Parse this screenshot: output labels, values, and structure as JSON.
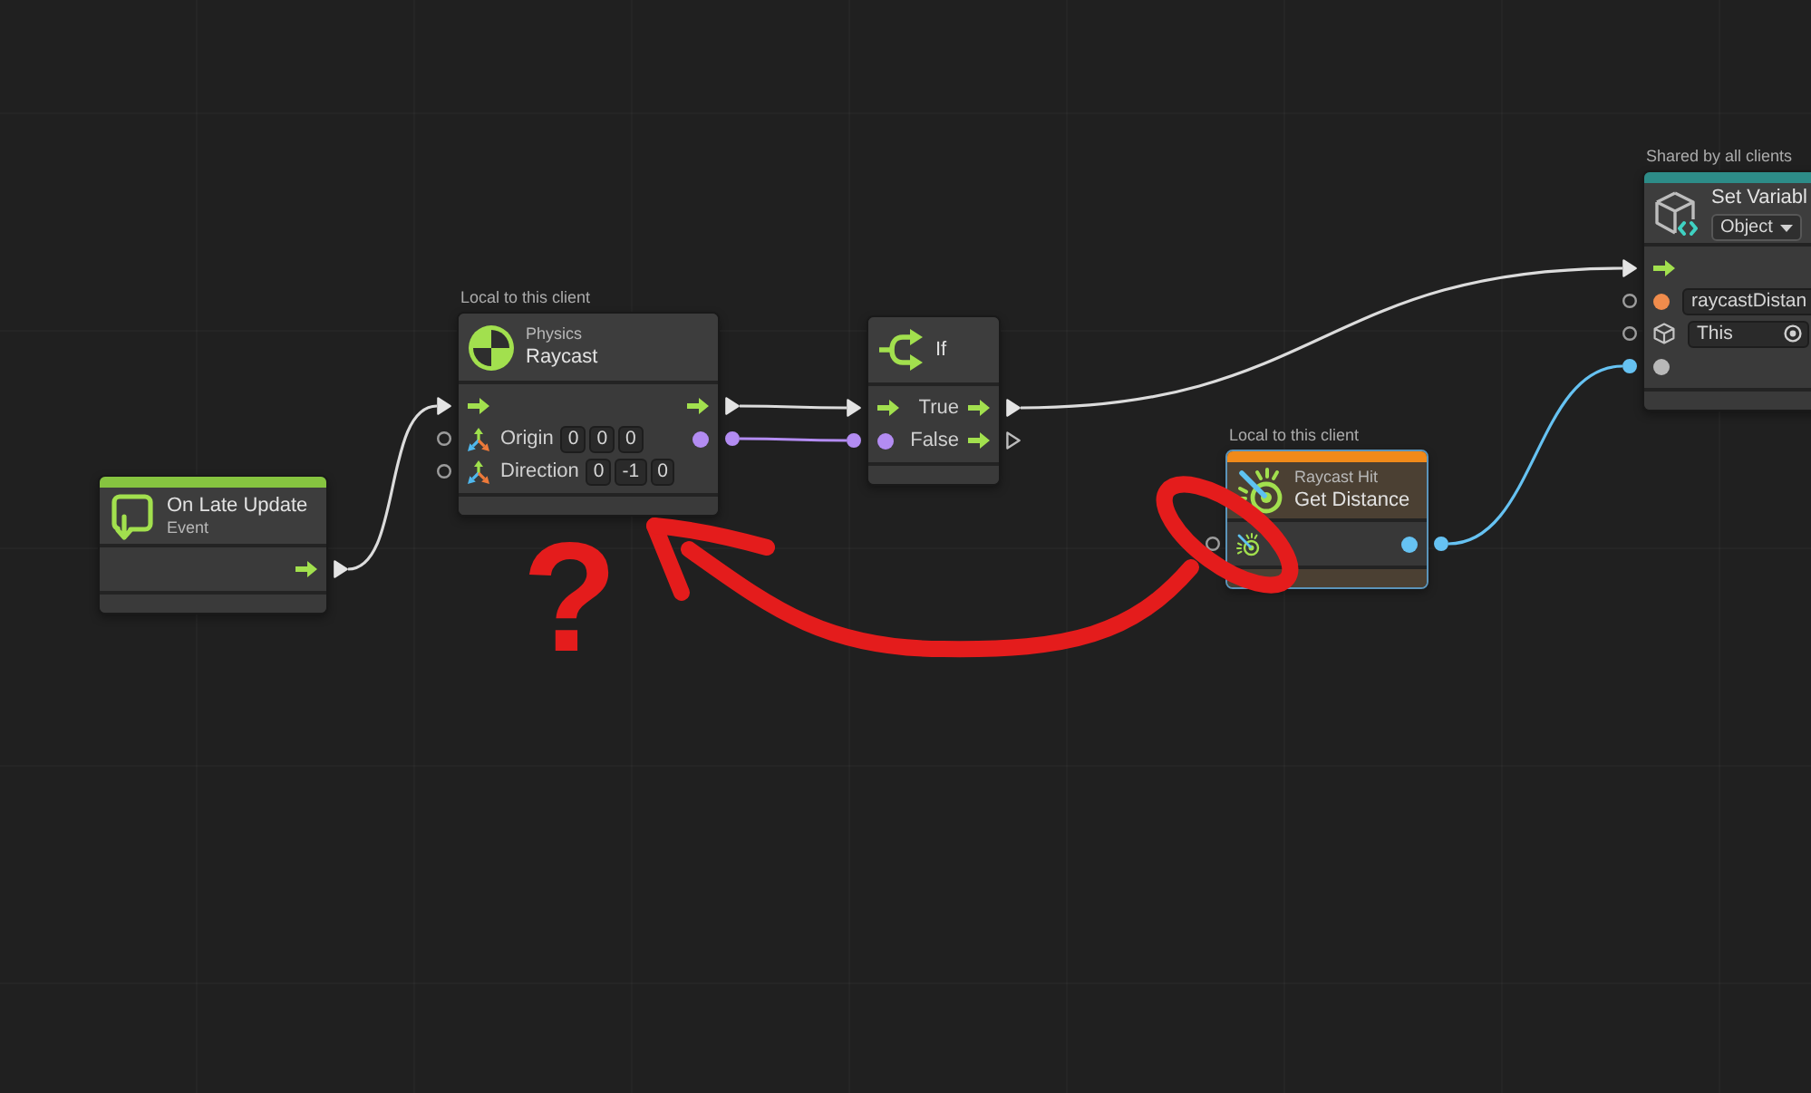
{
  "nodes": [
    {
      "kind": "event",
      "title": "On Late Update",
      "subtitle": "Event",
      "color": "#86c440",
      "selected": false,
      "rows": [
        {
          "out": {
            "kind": "flow",
            "connected": true
          }
        }
      ]
    },
    {
      "kind": "raycast",
      "scope": "Local to this client",
      "category": "Physics",
      "title": "Raycast",
      "selected": false,
      "rows": [
        {
          "in": {
            "kind": "flow",
            "connected": true
          },
          "out": {
            "kind": "flow",
            "connected": true
          }
        },
        {
          "in": {
            "kind": "vector",
            "connected": false,
            "label": "Origin",
            "fields": [
              "0",
              "0",
              "0"
            ]
          },
          "out": {
            "kind": "value",
            "color": "#b38cf2",
            "connected": true
          }
        },
        {
          "in": {
            "kind": "vector",
            "connected": false,
            "label": "Direction",
            "fields": [
              "0",
              "-1",
              "0"
            ]
          }
        }
      ]
    },
    {
      "kind": "branch",
      "title": "If",
      "selected": false,
      "rows": [
        {
          "in": {
            "kind": "flow",
            "connected": true
          },
          "out": {
            "kind": "flow",
            "connected": true,
            "label": "True"
          }
        },
        {
          "in": {
            "kind": "value",
            "color": "#b38cf2",
            "connected": true
          },
          "out": {
            "kind": "flow",
            "connected": false,
            "label": "False"
          }
        }
      ]
    },
    {
      "kind": "getter",
      "scope": "Local to this client",
      "category": "Raycast Hit",
      "title": "Get Distance",
      "color": "#f08a1a",
      "selected": true,
      "rows": [
        {
          "in": {
            "kind": "hit",
            "connected": false
          },
          "out": {
            "kind": "value",
            "color": "#66c2f2",
            "connected": true
          }
        }
      ]
    },
    {
      "kind": "setter",
      "scope": "Shared by all clients",
      "title": "Set Variabl",
      "dropdown": "Object",
      "color": "#2d8c88",
      "selected": false,
      "rows": [
        {
          "in": {
            "kind": "flow",
            "connected": true
          }
        },
        {
          "in": {
            "kind": "value",
            "color": "#f08c4c",
            "connected": false,
            "fields": [
              "raycastDistan"
            ]
          }
        },
        {
          "in": {
            "kind": "object",
            "connected": false,
            "fields": [
              "This"
            ]
          }
        },
        {
          "in": {
            "kind": "value",
            "color": "#b8b8b8",
            "connected": true
          }
        }
      ]
    }
  ],
  "annotation": {
    "mark": "?"
  }
}
